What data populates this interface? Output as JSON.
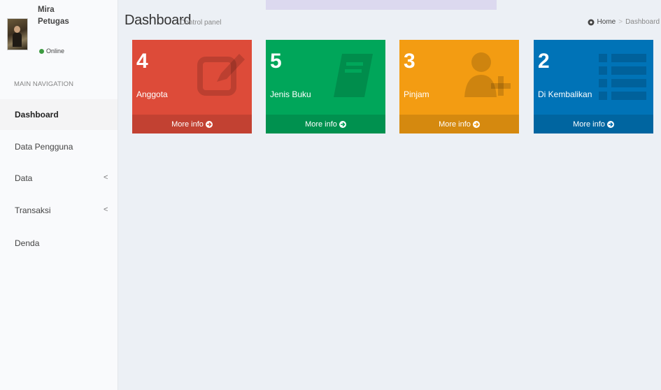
{
  "colors": {
    "red": "#dd4b39",
    "green": "#00a65a",
    "orange": "#f39c12",
    "blue": "#0073b7"
  },
  "user": {
    "name": "Mira Petugas",
    "status": "Online"
  },
  "sidebar": {
    "header": "MAIN NAVIGATION",
    "items": [
      {
        "label": "Dashboard",
        "active": true
      },
      {
        "label": "Data Pengguna"
      },
      {
        "label": "Data",
        "chevron": "<"
      },
      {
        "label": "Transaksi",
        "chevron": "<"
      },
      {
        "label": "Denda"
      }
    ]
  },
  "header": {
    "title": "Dashboard",
    "subtitle": "Control panel"
  },
  "breadcrumb": {
    "home": "Home",
    "current": "Dashboard",
    "separator": ">"
  },
  "boxes": [
    {
      "value": "4",
      "label": "Anggota",
      "more": "More info",
      "icon": "edit-icon"
    },
    {
      "value": "5",
      "label": "Jenis Buku",
      "more": "More info",
      "icon": "book-icon"
    },
    {
      "value": "3",
      "label": "Pinjam",
      "more": "More info",
      "icon": "user-plus-icon"
    },
    {
      "value": "2",
      "label": "Di Kembalikan",
      "more": "More info",
      "icon": "list-icon"
    }
  ]
}
